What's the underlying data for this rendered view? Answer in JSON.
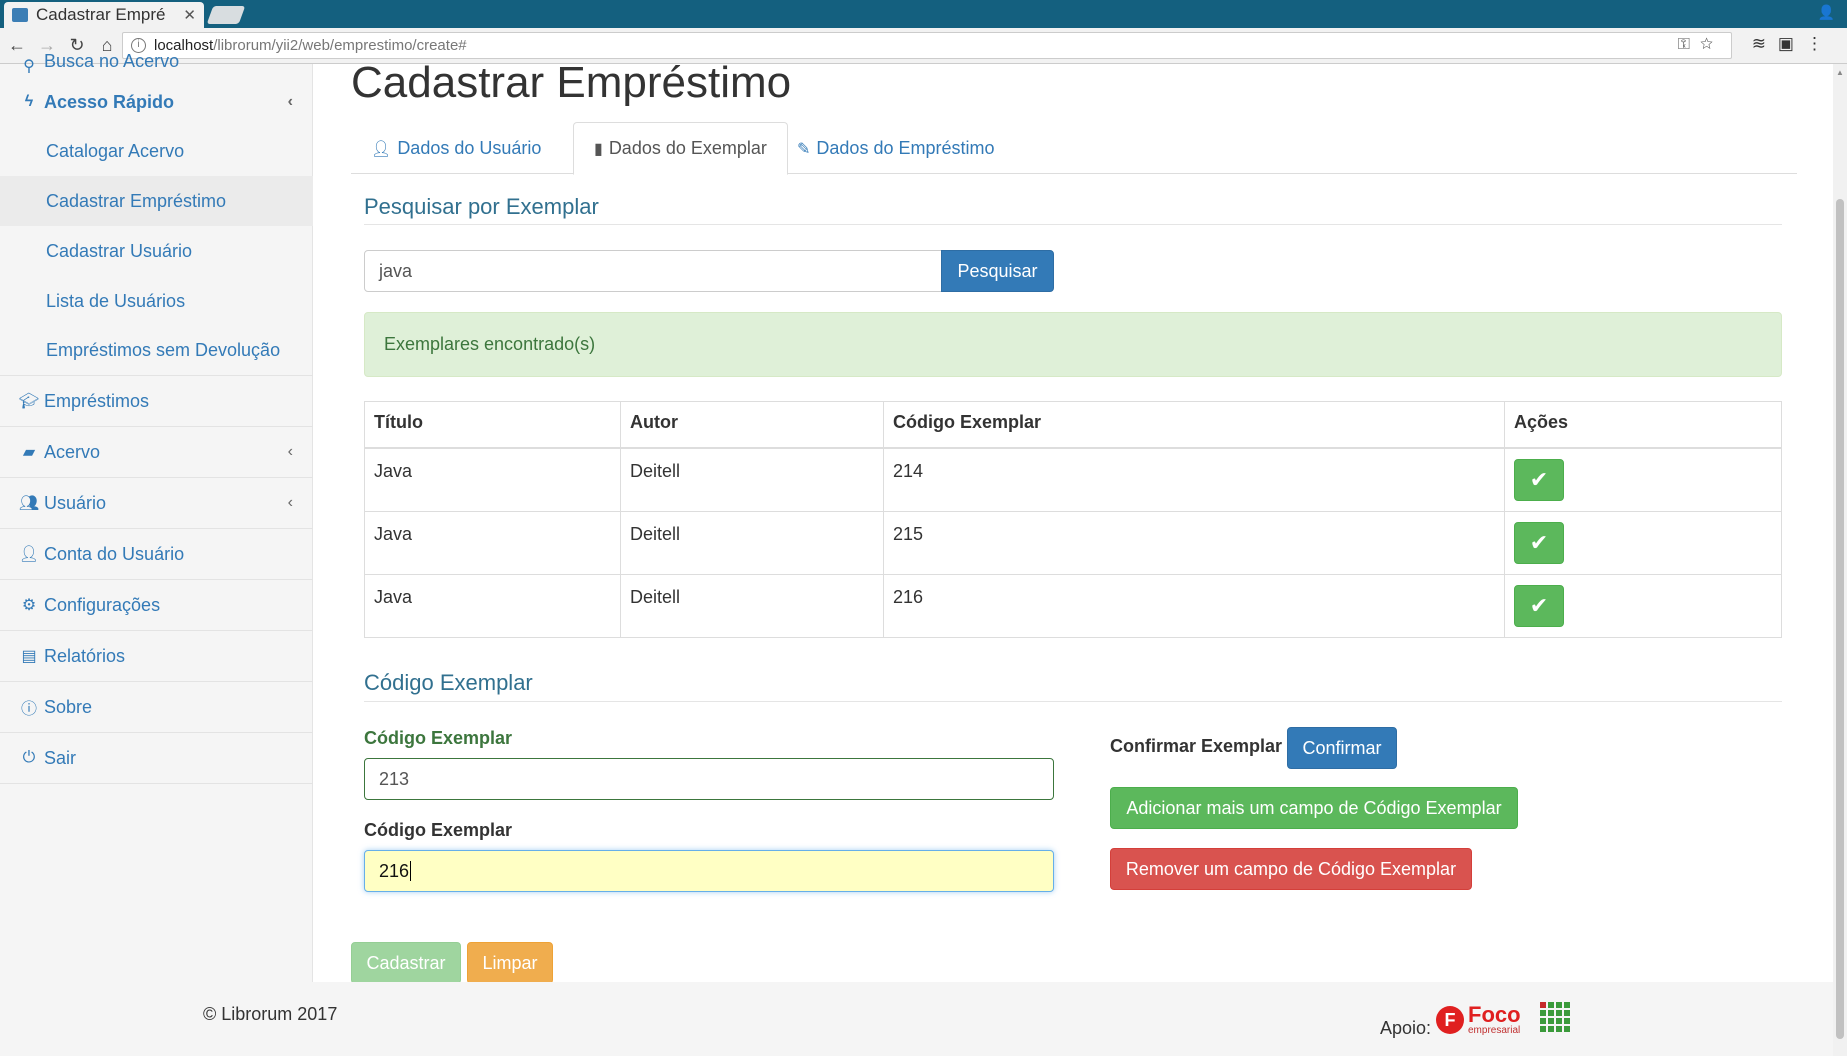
{
  "browser": {
    "tab_title": "Cadastrar Empré",
    "url_host": "localhost",
    "url_path": "/librorum/yii2/web/emprestimo/create#"
  },
  "sidebar": {
    "top_partial": "Busca no Acervo",
    "quick_access": "Acesso Rápido",
    "sub_items": [
      "Catalogar Acervo",
      "Cadastrar Empréstimo",
      "Cadastrar Usuário",
      "Lista de Usuários",
      "Empréstimos sem Devolução"
    ],
    "items": [
      "Empréstimos",
      "Acervo",
      "Usuário",
      "Conta do Usuário",
      "Configurações",
      "Relatórios",
      "Sobre",
      "Sair"
    ]
  },
  "page": {
    "title": "Cadastrar Empréstimo",
    "tabs": [
      "Dados do Usuário",
      "Dados do Exemplar",
      "Dados do Empréstimo"
    ],
    "active_tab": "Dados do Exemplar"
  },
  "search": {
    "section_title": "Pesquisar por Exemplar",
    "value": "java",
    "button": "Pesquisar",
    "alert": "Exemplares encontrado(s)"
  },
  "results": {
    "headers": [
      "Título",
      "Autor",
      "Código Exemplar",
      "Ações"
    ],
    "rows": [
      {
        "titulo": "Java",
        "autor": "Deitell",
        "codigo": "214"
      },
      {
        "titulo": "Java",
        "autor": "Deitell",
        "codigo": "215"
      },
      {
        "titulo": "Java",
        "autor": "Deitell",
        "codigo": "216"
      }
    ]
  },
  "codigo": {
    "section_title": "Código Exemplar",
    "field1_label": "Código Exemplar",
    "field1_value": "213",
    "field2_label": "Código Exemplar",
    "field2_value": "216",
    "confirm_label": "Confirmar Exemplar",
    "confirm_button": "Confirmar",
    "add_button": "Adicionar mais um campo de Código Exemplar",
    "remove_button": "Remover um campo de Código Exemplar"
  },
  "form_actions": {
    "submit": "Cadastrar",
    "clear": "Limpar"
  },
  "footer": {
    "copyright": "© Librorum 2017",
    "apoio": "Apoio:",
    "foco": "Foco",
    "foco_sub": "empresarial"
  },
  "colors": {
    "link": "#337ab7",
    "success": "#5cb85c",
    "danger": "#d9534f",
    "warning": "#f0ad4e",
    "chrome_tabbar": "#14607f"
  }
}
